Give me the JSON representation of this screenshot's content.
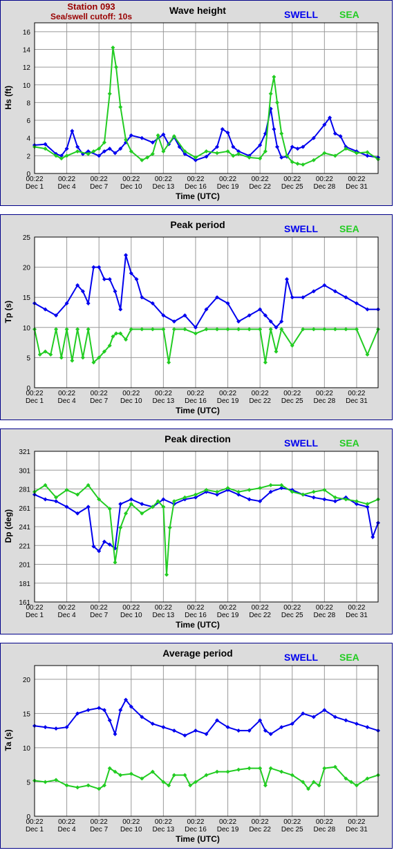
{
  "station": {
    "name": "Station 093",
    "cutoff": "Sea/swell cutoff: 10s"
  },
  "legend": {
    "swell": "SWELL",
    "sea": "SEA"
  },
  "colors": {
    "swell": "#0000ee",
    "sea": "#22cc22",
    "grid": "#999999"
  },
  "x_tick_time": "00:22",
  "chart_data": [
    {
      "type": "line",
      "title": "Wave height",
      "ylabel": "Hs (ft)",
      "xlabel": "Time (UTC)",
      "ylim": [
        0,
        17
      ],
      "yticks": [
        0,
        2,
        4,
        6,
        8,
        10,
        12,
        14,
        16
      ],
      "xlim_days": [
        1,
        33
      ],
      "xticks": [
        "Dec 1",
        "Dec 4",
        "Dec 7",
        "Dec 10",
        "Dec 13",
        "Dec 16",
        "Dec 19",
        "Dec 22",
        "Dec 25",
        "Dec 28",
        "Dec 31"
      ],
      "series": [
        {
          "name": "SWELL",
          "x": [
            1,
            2,
            3,
            3.5,
            4,
            4.5,
            5,
            5.5,
            6,
            7,
            7.5,
            8,
            8.5,
            9,
            9.5,
            10,
            11,
            12,
            13,
            13.5,
            14,
            14.5,
            15,
            16,
            17,
            18,
            18.5,
            19,
            19.5,
            20,
            21,
            22,
            22.5,
            23,
            23.3,
            23.6,
            24,
            24.5,
            25,
            25.5,
            26,
            27,
            28,
            28.5,
            29,
            29.5,
            30,
            31,
            32,
            33
          ],
          "values": [
            3.2,
            3.3,
            2.2,
            2.0,
            2.8,
            4.8,
            3.0,
            2.2,
            2.5,
            2.0,
            2.5,
            2.8,
            2.3,
            2.8,
            3.5,
            4.3,
            4.0,
            3.5,
            4.4,
            3.3,
            4.1,
            3.0,
            2.2,
            1.5,
            1.9,
            3.0,
            5.0,
            4.6,
            3.0,
            2.5,
            2.0,
            3.2,
            4.5,
            7.3,
            5.0,
            3.0,
            1.8,
            1.9,
            3.0,
            2.8,
            3.0,
            4.0,
            5.5,
            6.3,
            4.5,
            4.2,
            3.0,
            2.5,
            2.0,
            1.8
          ]
        },
        {
          "name": "SEA",
          "x": [
            1,
            2,
            3,
            3.5,
            4,
            5,
            6,
            6.5,
            7,
            7.5,
            8,
            8.3,
            8.6,
            9,
            9.5,
            10,
            11,
            11.5,
            12,
            12.5,
            13,
            14,
            15,
            16,
            17,
            18,
            19,
            19.5,
            20,
            21,
            22,
            22.5,
            23,
            23.3,
            23.6,
            24,
            24.5,
            25,
            25.5,
            26,
            27,
            28,
            29,
            30,
            31,
            32,
            33
          ],
          "values": [
            3.0,
            2.8,
            2.0,
            1.7,
            2.0,
            2.5,
            2.2,
            2.5,
            2.8,
            3.5,
            9.0,
            14.2,
            12.0,
            7.5,
            3.8,
            2.5,
            1.5,
            1.8,
            2.2,
            4.3,
            2.5,
            4.2,
            2.5,
            1.8,
            2.5,
            2.3,
            2.5,
            2.0,
            2.2,
            1.8,
            1.7,
            2.5,
            9.0,
            10.9,
            8.0,
            4.5,
            2.0,
            1.3,
            1.1,
            1.0,
            1.5,
            2.3,
            2.0,
            2.8,
            2.3,
            2.4,
            1.6
          ]
        }
      ]
    },
    {
      "type": "line",
      "title": "Peak period",
      "ylabel": "Tp (s)",
      "xlabel": "Time (UTC)",
      "ylim": [
        0,
        25
      ],
      "yticks": [
        0,
        5,
        10,
        15,
        20,
        25
      ],
      "xlim_days": [
        1,
        33
      ],
      "xticks": [
        "Dec 1",
        "Dec 4",
        "Dec 7",
        "Dec 10",
        "Dec 13",
        "Dec 16",
        "Dec 19",
        "Dec 22",
        "Dec 25",
        "Dec 28",
        "Dec 31"
      ],
      "series": [
        {
          "name": "SWELL",
          "x": [
            1,
            2,
            3,
            4,
            5,
            5.5,
            6,
            6.5,
            7,
            7.5,
            8,
            8.5,
            9,
            9.5,
            10,
            10.5,
            11,
            12,
            13,
            14,
            15,
            16,
            17,
            18,
            19,
            20,
            21,
            22,
            22.5,
            23,
            23.5,
            24,
            24.5,
            25,
            26,
            27,
            28,
            29,
            30,
            31,
            32,
            33
          ],
          "values": [
            14,
            13,
            12,
            14,
            17,
            16,
            14,
            20,
            20,
            18,
            18,
            16,
            13,
            22,
            19,
            18,
            15,
            14,
            12,
            11,
            12,
            10,
            13,
            15,
            14,
            11,
            12,
            13,
            12,
            11,
            10,
            11,
            18,
            15,
            15,
            16,
            17,
            16,
            15,
            14,
            13,
            13
          ]
        },
        {
          "name": "SEA",
          "x": [
            1,
            1.5,
            2,
            2.5,
            3,
            3.5,
            4,
            4.5,
            5,
            5.5,
            6,
            6.5,
            7,
            7.5,
            8,
            8.3,
            8.6,
            9,
            9.5,
            10,
            11,
            12,
            13,
            13.5,
            14,
            15,
            16,
            17,
            18,
            19,
            20,
            21,
            22,
            22.5,
            23,
            23.5,
            24,
            25,
            26,
            27,
            28,
            29,
            30,
            31,
            32,
            33
          ],
          "values": [
            9.7,
            5.5,
            6.0,
            5.5,
            9.7,
            5.0,
            9.7,
            4.5,
            9.7,
            5.0,
            9.7,
            4.2,
            5.0,
            6.0,
            7.0,
            8.5,
            9.0,
            9.0,
            8.0,
            9.7,
            9.7,
            9.7,
            9.7,
            4.2,
            9.7,
            9.7,
            9.0,
            9.7,
            9.7,
            9.7,
            9.7,
            9.7,
            9.7,
            4.2,
            9.7,
            6.0,
            9.7,
            7.0,
            9.7,
            9.7,
            9.7,
            9.7,
            9.7,
            9.7,
            5.5,
            9.7
          ]
        }
      ]
    },
    {
      "type": "line",
      "title": "Peak direction",
      "ylabel": "Dp (deg)",
      "xlabel": "Time (UTC)",
      "ylim": [
        161,
        321
      ],
      "yticks": [
        161,
        181,
        201,
        221,
        241,
        261,
        281,
        301,
        321
      ],
      "xlim_days": [
        1,
        33
      ],
      "xticks": [
        "Dec 1",
        "Dec 4",
        "Dec 7",
        "Dec 10",
        "Dec 13",
        "Dec 16",
        "Dec 19",
        "Dec 22",
        "Dec 25",
        "Dec 28",
        "Dec 31"
      ],
      "series": [
        {
          "name": "SWELL",
          "x": [
            1,
            2,
            3,
            4,
            5,
            6,
            6.5,
            7,
            7.5,
            8,
            8.5,
            9,
            10,
            11,
            12,
            13,
            14,
            15,
            16,
            17,
            18,
            19,
            20,
            21,
            22,
            23,
            24,
            25,
            26,
            27,
            28,
            29,
            30,
            31,
            32,
            32.5,
            33
          ],
          "values": [
            275,
            270,
            268,
            262,
            255,
            262,
            220,
            215,
            225,
            222,
            218,
            265,
            270,
            265,
            262,
            270,
            265,
            270,
            272,
            278,
            275,
            280,
            275,
            270,
            268,
            278,
            282,
            280,
            275,
            272,
            270,
            268,
            272,
            265,
            262,
            230,
            245
          ]
        },
        {
          "name": "SEA",
          "x": [
            1,
            2,
            3,
            4,
            5,
            6,
            7,
            8,
            8.5,
            9,
            9.5,
            10,
            11,
            12,
            12.5,
            13,
            13.3,
            13.6,
            14,
            15,
            16,
            17,
            18,
            19,
            20,
            21,
            22,
            23,
            24,
            25,
            26,
            27,
            28,
            29,
            30,
            31,
            32,
            33
          ],
          "values": [
            278,
            285,
            272,
            280,
            275,
            285,
            270,
            260,
            203,
            240,
            255,
            265,
            255,
            262,
            268,
            262,
            190,
            240,
            268,
            272,
            275,
            280,
            278,
            282,
            278,
            280,
            282,
            285,
            285,
            278,
            275,
            278,
            280,
            272,
            270,
            268,
            265,
            270
          ]
        }
      ]
    },
    {
      "type": "line",
      "title": "Average period",
      "ylabel": "Ta (s)",
      "xlabel": "Time (UTC)",
      "ylim": [
        0,
        22
      ],
      "yticks": [
        0,
        5,
        10,
        15,
        20
      ],
      "xlim_days": [
        1,
        33
      ],
      "xticks": [
        "Dec 1",
        "Dec 4",
        "Dec 7",
        "Dec 10",
        "Dec 13",
        "Dec 16",
        "Dec 19",
        "Dec 22",
        "Dec 25",
        "Dec 28",
        "Dec 31"
      ],
      "series": [
        {
          "name": "SWELL",
          "x": [
            1,
            2,
            3,
            4,
            5,
            6,
            7,
            7.5,
            8,
            8.5,
            9,
            9.5,
            10,
            11,
            12,
            13,
            14,
            15,
            16,
            17,
            18,
            19,
            20,
            21,
            22,
            22.5,
            23,
            24,
            25,
            26,
            27,
            28,
            29,
            30,
            31,
            32,
            33
          ],
          "values": [
            13.2,
            13.0,
            12.8,
            13.0,
            15.0,
            15.5,
            15.8,
            15.5,
            14.0,
            12.0,
            15.5,
            17.0,
            16.0,
            14.5,
            13.5,
            13.0,
            12.5,
            11.8,
            12.5,
            12.0,
            14.0,
            13.0,
            12.5,
            12.5,
            14.0,
            12.5,
            12.0,
            13.0,
            13.5,
            15.0,
            14.5,
            15.5,
            14.5,
            14.0,
            13.5,
            13.0,
            12.5
          ]
        },
        {
          "name": "SEA",
          "x": [
            1,
            2,
            3,
            4,
            5,
            6,
            7,
            7.5,
            8,
            8.5,
            9,
            10,
            11,
            12,
            13,
            13.5,
            14,
            15,
            15.5,
            16,
            17,
            18,
            19,
            20,
            21,
            22,
            22.5,
            23,
            24,
            25,
            26,
            26.5,
            27,
            27.5,
            28,
            29,
            30,
            30.5,
            31,
            32,
            33
          ],
          "values": [
            5.2,
            5.0,
            5.3,
            4.5,
            4.2,
            4.5,
            4.0,
            4.5,
            7.0,
            6.5,
            6.0,
            6.2,
            5.5,
            6.5,
            5.0,
            4.5,
            6.0,
            6.0,
            4.5,
            5.0,
            6.0,
            6.5,
            6.5,
            6.8,
            7.0,
            7.0,
            4.5,
            7.0,
            6.5,
            6.0,
            5.0,
            4.0,
            5.0,
            4.5,
            7.0,
            7.2,
            5.5,
            5.0,
            4.5,
            5.5,
            6.0
          ]
        }
      ]
    }
  ]
}
